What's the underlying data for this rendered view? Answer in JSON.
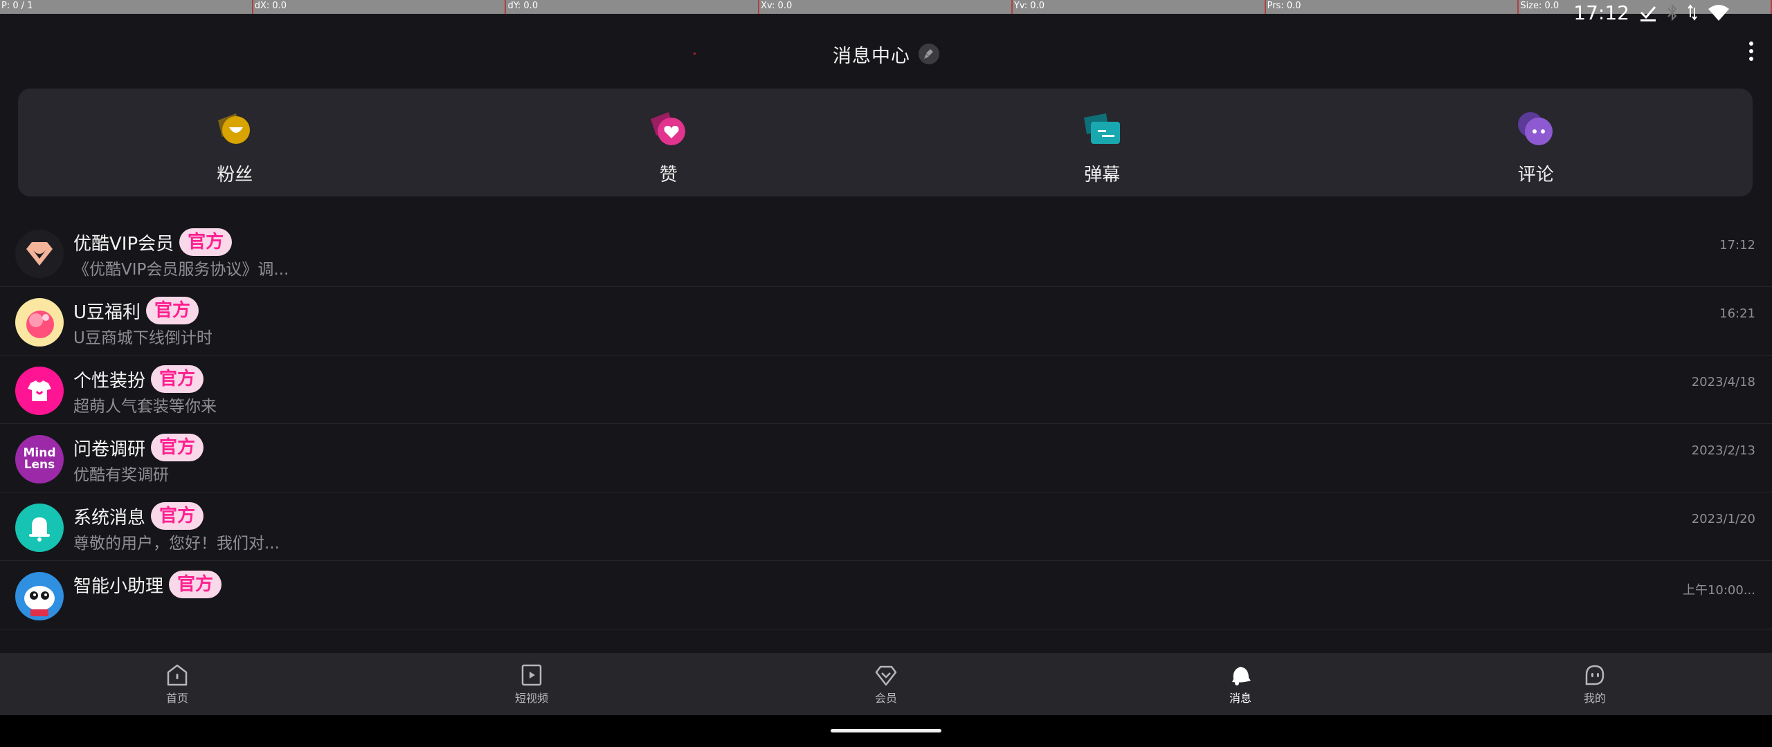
{
  "debug": {
    "cells": [
      "P: 0 / 1",
      "dX: 0.0",
      "dY: 0.0",
      "Xv: 0.0",
      "Yv: 0.0",
      "Prs: 0.0",
      "Size: 0.0"
    ]
  },
  "status": {
    "time": "17:12"
  },
  "header": {
    "title": "消息中心"
  },
  "categories": [
    {
      "label": "粉丝",
      "icon": "fans-icon",
      "color": "#d9a400"
    },
    {
      "label": "赞",
      "icon": "like-heart-icon",
      "color": "#e2338f"
    },
    {
      "label": "弹幕",
      "icon": "danmaku-icon",
      "color": "#1aa8b0"
    },
    {
      "label": "评论",
      "icon": "comment-icon",
      "color": "#8e5ad2"
    }
  ],
  "messages": [
    {
      "name": "优酷VIP会员",
      "badge": "官方",
      "preview": "《优酷VIP会员服务协议》调...",
      "time": "17:12",
      "avatar": "vip-diamond-avatar"
    },
    {
      "name": "U豆福利",
      "badge": "官方",
      "preview": "U豆商城下线倒计时",
      "time": "16:21",
      "avatar": "udou-avatar"
    },
    {
      "name": "个性装扮",
      "badge": "官方",
      "preview": "超萌人气套装等你来",
      "time": "2023/4/18",
      "avatar": "tshirt-avatar"
    },
    {
      "name": "问卷调研",
      "badge": "官方",
      "preview": "优酷有奖调研",
      "time": "2023/2/13",
      "avatar": "mindlens-avatar",
      "avatar_text": "Mind\nLens"
    },
    {
      "name": "系统消息",
      "badge": "官方",
      "preview": "尊敬的用户，您好！我们对...",
      "time": "2023/1/20",
      "avatar": "bell-avatar"
    },
    {
      "name": "智能小助理",
      "badge": "官方",
      "preview": "",
      "time": "上午10:00...",
      "avatar": "assistant-avatar"
    }
  ],
  "tabs": [
    {
      "label": "首页",
      "icon": "home-icon",
      "active": false
    },
    {
      "label": "短视频",
      "icon": "short-video-icon",
      "active": false
    },
    {
      "label": "会员",
      "icon": "vip-diamond-icon",
      "active": false
    },
    {
      "label": "消息",
      "icon": "bell-icon",
      "active": true
    },
    {
      "label": "我的",
      "icon": "profile-icon",
      "active": false
    }
  ]
}
